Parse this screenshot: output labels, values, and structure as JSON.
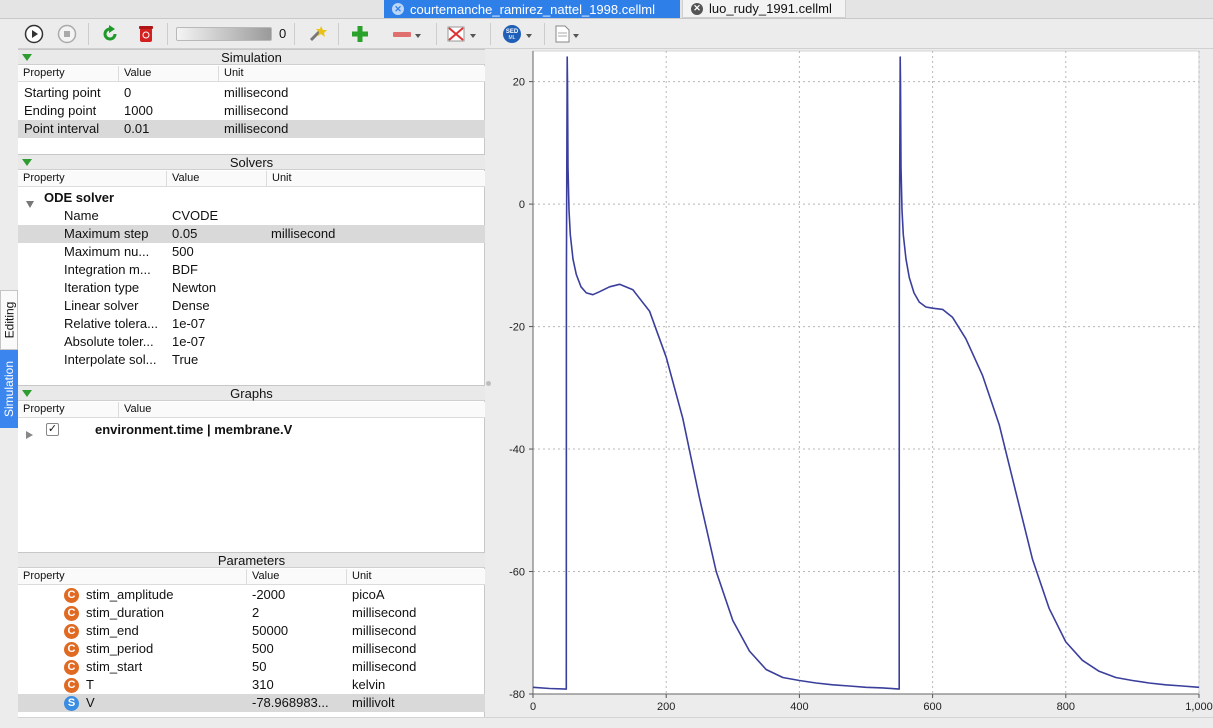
{
  "tabs": [
    {
      "label": "courtemanche_ramirez_nattel_1998.cellml",
      "active": true
    },
    {
      "label": "luo_rudy_1991.cellml",
      "active": false
    }
  ],
  "side_tabs": {
    "editing": "Editing",
    "simulation": "Simulation"
  },
  "toolbar": {
    "slider_value": "0",
    "icons": [
      "run-icon",
      "stop-icon",
      "reset-icon",
      "clear-icon",
      "slider",
      "development-mode-icon",
      "add-graph-icon",
      "remove-graph-icon",
      "csv-export-icon",
      "sedml-export-icon",
      "cellml-export-icon"
    ],
    "sedml_label": "SED ML"
  },
  "simulation": {
    "title": "Simulation",
    "columns": [
      "Property",
      "Value",
      "Unit"
    ],
    "rows": [
      {
        "property": "Starting point",
        "value": "0",
        "unit": "millisecond"
      },
      {
        "property": "Ending point",
        "value": "1000",
        "unit": "millisecond"
      },
      {
        "property": "Point interval",
        "value": "0.01",
        "unit": "millisecond"
      }
    ]
  },
  "solvers": {
    "title": "Solvers",
    "columns": [
      "Property",
      "Value",
      "Unit"
    ],
    "group": "ODE solver",
    "rows": [
      {
        "property": "Name",
        "value": "CVODE",
        "unit": ""
      },
      {
        "property": "Maximum step",
        "value": "0.05",
        "unit": "millisecond"
      },
      {
        "property": "Maximum nu...",
        "value": "500",
        "unit": ""
      },
      {
        "property": "Integration m...",
        "value": "BDF",
        "unit": ""
      },
      {
        "property": "Iteration type",
        "value": "Newton",
        "unit": ""
      },
      {
        "property": "Linear solver",
        "value": "Dense",
        "unit": ""
      },
      {
        "property": "Relative tolera...",
        "value": "1e-07",
        "unit": ""
      },
      {
        "property": "Absolute toler...",
        "value": "1e-07",
        "unit": ""
      },
      {
        "property": "Interpolate sol...",
        "value": "True",
        "unit": ""
      }
    ]
  },
  "graphs": {
    "title": "Graphs",
    "columns": [
      "Property",
      "Value"
    ],
    "item": "environment.time | membrane.V"
  },
  "parameters": {
    "title": "Parameters",
    "columns": [
      "Property",
      "Value",
      "Unit"
    ],
    "rows": [
      {
        "icon": "C",
        "property": "stim_amplitude",
        "value": "-2000",
        "unit": "picoA"
      },
      {
        "icon": "C",
        "property": "stim_duration",
        "value": "2",
        "unit": "millisecond"
      },
      {
        "icon": "C",
        "property": "stim_end",
        "value": "50000",
        "unit": "millisecond"
      },
      {
        "icon": "C",
        "property": "stim_period",
        "value": "500",
        "unit": "millisecond"
      },
      {
        "icon": "C",
        "property": "stim_start",
        "value": "50",
        "unit": "millisecond"
      },
      {
        "icon": "C",
        "property": "T",
        "value": "310",
        "unit": "kelvin"
      },
      {
        "icon": "S",
        "property": "V",
        "value": "-78.968983...",
        "unit": "millivolt"
      }
    ]
  },
  "colors": {
    "accent": "#2f7fe8",
    "trace": "#3b3f9c"
  },
  "chart_data": {
    "type": "line",
    "title": "",
    "xlabel": "",
    "ylabel": "",
    "xlim": [
      0,
      1000
    ],
    "ylim": [
      -80,
      25
    ],
    "xticks": [
      0,
      200,
      400,
      600,
      800,
      1000
    ],
    "xtick_labels": [
      "0",
      "200",
      "400",
      "600",
      "800",
      "1,000"
    ],
    "yticks": [
      -80,
      -60,
      -40,
      -20,
      0,
      20
    ],
    "grid": true,
    "series": [
      {
        "x": [
          0,
          25,
          50,
          50.2,
          51.3,
          51.8,
          52.5,
          54,
          56,
          60,
          65,
          72,
          80,
          90,
          100,
          115,
          130,
          150,
          175,
          200,
          225,
          250,
          275,
          300,
          325,
          350,
          375,
          400,
          425,
          450,
          475,
          500,
          525,
          549.8,
          550,
          551.3,
          551.8,
          552.5,
          554,
          556,
          560,
          565,
          572,
          580,
          590,
          600,
          615,
          630,
          650,
          675,
          700,
          725,
          750,
          775,
          800,
          825,
          850,
          875,
          900,
          925,
          950,
          975,
          1000
        ],
        "y": [
          -78.9,
          -79.1,
          -79.2,
          -12,
          24,
          20,
          6,
          -1,
          -5,
          -9,
          -11.5,
          -13.5,
          -14.5,
          -14.8,
          -14.3,
          -13.5,
          -13.1,
          -14,
          -17.5,
          -25,
          -35,
          -48,
          -60,
          -68,
          -73,
          -76,
          -77.3,
          -77.8,
          -78.2,
          -78.5,
          -78.7,
          -78.9,
          -79,
          -79.2,
          -12,
          24,
          20,
          6,
          -1,
          -5,
          -9,
          -12,
          -14.5,
          -16,
          -16.8,
          -17,
          -17.2,
          -18.5,
          -22,
          -28,
          -36,
          -47,
          -58,
          -66,
          -71.5,
          -74.5,
          -76.3,
          -77.3,
          -77.8,
          -78.2,
          -78.5,
          -78.7,
          -78.9
        ]
      }
    ]
  }
}
